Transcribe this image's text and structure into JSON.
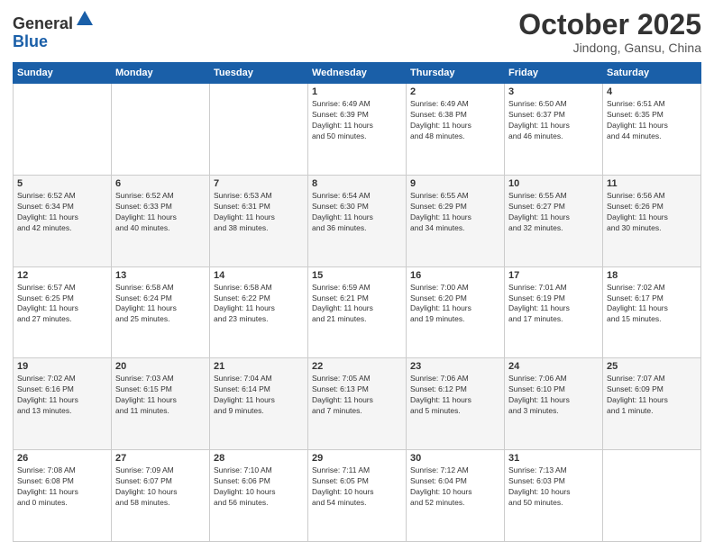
{
  "header": {
    "logo_line1": "General",
    "logo_line2": "Blue",
    "month": "October 2025",
    "location": "Jindong, Gansu, China"
  },
  "weekdays": [
    "Sunday",
    "Monday",
    "Tuesday",
    "Wednesday",
    "Thursday",
    "Friday",
    "Saturday"
  ],
  "weeks": [
    [
      {
        "day": "",
        "info": ""
      },
      {
        "day": "",
        "info": ""
      },
      {
        "day": "",
        "info": ""
      },
      {
        "day": "1",
        "info": "Sunrise: 6:49 AM\nSunset: 6:39 PM\nDaylight: 11 hours\nand 50 minutes."
      },
      {
        "day": "2",
        "info": "Sunrise: 6:49 AM\nSunset: 6:38 PM\nDaylight: 11 hours\nand 48 minutes."
      },
      {
        "day": "3",
        "info": "Sunrise: 6:50 AM\nSunset: 6:37 PM\nDaylight: 11 hours\nand 46 minutes."
      },
      {
        "day": "4",
        "info": "Sunrise: 6:51 AM\nSunset: 6:35 PM\nDaylight: 11 hours\nand 44 minutes."
      }
    ],
    [
      {
        "day": "5",
        "info": "Sunrise: 6:52 AM\nSunset: 6:34 PM\nDaylight: 11 hours\nand 42 minutes."
      },
      {
        "day": "6",
        "info": "Sunrise: 6:52 AM\nSunset: 6:33 PM\nDaylight: 11 hours\nand 40 minutes."
      },
      {
        "day": "7",
        "info": "Sunrise: 6:53 AM\nSunset: 6:31 PM\nDaylight: 11 hours\nand 38 minutes."
      },
      {
        "day": "8",
        "info": "Sunrise: 6:54 AM\nSunset: 6:30 PM\nDaylight: 11 hours\nand 36 minutes."
      },
      {
        "day": "9",
        "info": "Sunrise: 6:55 AM\nSunset: 6:29 PM\nDaylight: 11 hours\nand 34 minutes."
      },
      {
        "day": "10",
        "info": "Sunrise: 6:55 AM\nSunset: 6:27 PM\nDaylight: 11 hours\nand 32 minutes."
      },
      {
        "day": "11",
        "info": "Sunrise: 6:56 AM\nSunset: 6:26 PM\nDaylight: 11 hours\nand 30 minutes."
      }
    ],
    [
      {
        "day": "12",
        "info": "Sunrise: 6:57 AM\nSunset: 6:25 PM\nDaylight: 11 hours\nand 27 minutes."
      },
      {
        "day": "13",
        "info": "Sunrise: 6:58 AM\nSunset: 6:24 PM\nDaylight: 11 hours\nand 25 minutes."
      },
      {
        "day": "14",
        "info": "Sunrise: 6:58 AM\nSunset: 6:22 PM\nDaylight: 11 hours\nand 23 minutes."
      },
      {
        "day": "15",
        "info": "Sunrise: 6:59 AM\nSunset: 6:21 PM\nDaylight: 11 hours\nand 21 minutes."
      },
      {
        "day": "16",
        "info": "Sunrise: 7:00 AM\nSunset: 6:20 PM\nDaylight: 11 hours\nand 19 minutes."
      },
      {
        "day": "17",
        "info": "Sunrise: 7:01 AM\nSunset: 6:19 PM\nDaylight: 11 hours\nand 17 minutes."
      },
      {
        "day": "18",
        "info": "Sunrise: 7:02 AM\nSunset: 6:17 PM\nDaylight: 11 hours\nand 15 minutes."
      }
    ],
    [
      {
        "day": "19",
        "info": "Sunrise: 7:02 AM\nSunset: 6:16 PM\nDaylight: 11 hours\nand 13 minutes."
      },
      {
        "day": "20",
        "info": "Sunrise: 7:03 AM\nSunset: 6:15 PM\nDaylight: 11 hours\nand 11 minutes."
      },
      {
        "day": "21",
        "info": "Sunrise: 7:04 AM\nSunset: 6:14 PM\nDaylight: 11 hours\nand 9 minutes."
      },
      {
        "day": "22",
        "info": "Sunrise: 7:05 AM\nSunset: 6:13 PM\nDaylight: 11 hours\nand 7 minutes."
      },
      {
        "day": "23",
        "info": "Sunrise: 7:06 AM\nSunset: 6:12 PM\nDaylight: 11 hours\nand 5 minutes."
      },
      {
        "day": "24",
        "info": "Sunrise: 7:06 AM\nSunset: 6:10 PM\nDaylight: 11 hours\nand 3 minutes."
      },
      {
        "day": "25",
        "info": "Sunrise: 7:07 AM\nSunset: 6:09 PM\nDaylight: 11 hours\nand 1 minute."
      }
    ],
    [
      {
        "day": "26",
        "info": "Sunrise: 7:08 AM\nSunset: 6:08 PM\nDaylight: 11 hours\nand 0 minutes."
      },
      {
        "day": "27",
        "info": "Sunrise: 7:09 AM\nSunset: 6:07 PM\nDaylight: 10 hours\nand 58 minutes."
      },
      {
        "day": "28",
        "info": "Sunrise: 7:10 AM\nSunset: 6:06 PM\nDaylight: 10 hours\nand 56 minutes."
      },
      {
        "day": "29",
        "info": "Sunrise: 7:11 AM\nSunset: 6:05 PM\nDaylight: 10 hours\nand 54 minutes."
      },
      {
        "day": "30",
        "info": "Sunrise: 7:12 AM\nSunset: 6:04 PM\nDaylight: 10 hours\nand 52 minutes."
      },
      {
        "day": "31",
        "info": "Sunrise: 7:13 AM\nSunset: 6:03 PM\nDaylight: 10 hours\nand 50 minutes."
      },
      {
        "day": "",
        "info": ""
      }
    ]
  ]
}
